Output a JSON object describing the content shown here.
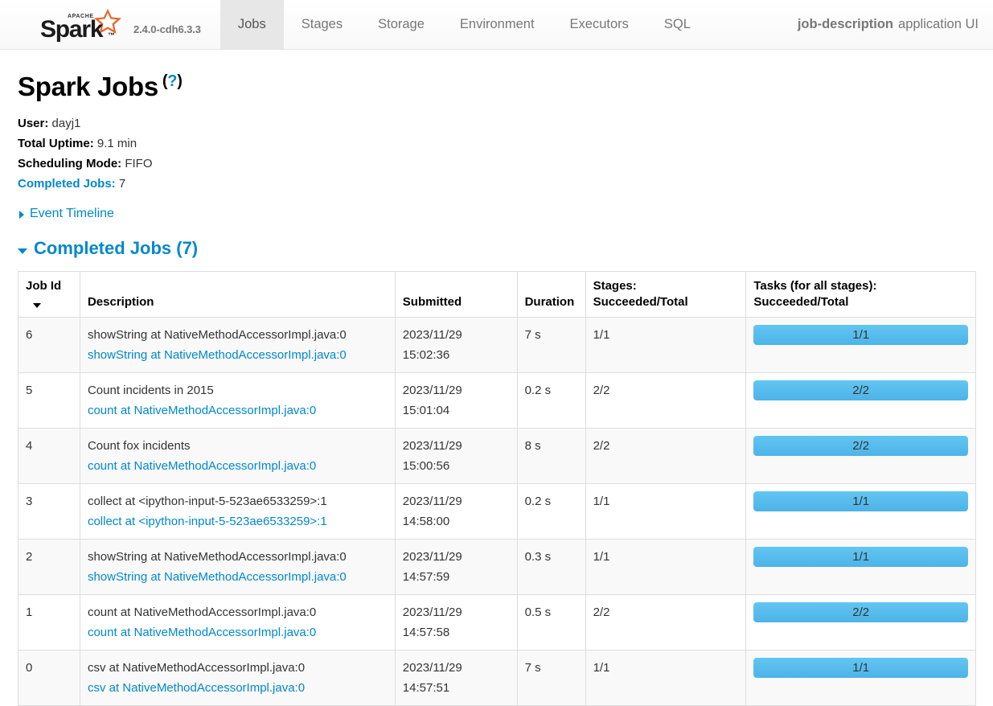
{
  "navbar": {
    "brand": {
      "name": "Spark",
      "apache": "APACHE",
      "icon": "spark-logo-icon"
    },
    "version": "2.4.0-cdh6.3.3",
    "tabs": [
      {
        "label": "Jobs",
        "active": true
      },
      {
        "label": "Stages",
        "active": false
      },
      {
        "label": "Storage",
        "active": false
      },
      {
        "label": "Environment",
        "active": false
      },
      {
        "label": "Executors",
        "active": false
      },
      {
        "label": "SQL",
        "active": false
      }
    ],
    "app_name": "job-description",
    "app_suffix": "application UI"
  },
  "page": {
    "title": "Spark Jobs",
    "help_open": "(",
    "help_mark": "?",
    "help_close": ")"
  },
  "summary": {
    "user_label": "User:",
    "user_value": "dayj1",
    "uptime_label": "Total Uptime:",
    "uptime_value": "9.1 min",
    "scheduling_label": "Scheduling Mode:",
    "scheduling_value": "FIFO",
    "completed_label": "Completed Jobs:",
    "completed_value": "7"
  },
  "event_timeline": {
    "label": "Event Timeline"
  },
  "completed_section": {
    "title": "Completed Jobs (7)"
  },
  "table": {
    "headers": {
      "job_id": "Job Id",
      "description": "Description",
      "submitted": "Submitted",
      "duration": "Duration",
      "stages_l1": "Stages:",
      "stages_l2": "Succeeded/Total",
      "tasks_l1": "Tasks (for all stages):",
      "tasks_l2": "Succeeded/Total"
    },
    "rows": [
      {
        "job_id": "6",
        "desc_main": "showString at NativeMethodAccessorImpl.java:0",
        "desc_link": "showString at NativeMethodAccessorImpl.java:0",
        "submitted_date": "2023/11/29",
        "submitted_time": "15:02:36",
        "duration": "7 s",
        "stages": "1/1",
        "tasks": "1/1"
      },
      {
        "job_id": "5",
        "desc_main": "Count incidents in 2015",
        "desc_link": "count at NativeMethodAccessorImpl.java:0",
        "submitted_date": "2023/11/29",
        "submitted_time": "15:01:04",
        "duration": "0.2 s",
        "stages": "2/2",
        "tasks": "2/2"
      },
      {
        "job_id": "4",
        "desc_main": "Count fox incidents",
        "desc_link": "count at NativeMethodAccessorImpl.java:0",
        "submitted_date": "2023/11/29",
        "submitted_time": "15:00:56",
        "duration": "8 s",
        "stages": "2/2",
        "tasks": "2/2"
      },
      {
        "job_id": "3",
        "desc_main": "collect at <ipython-input-5-523ae6533259>:1",
        "desc_link": "collect at <ipython-input-5-523ae6533259>:1",
        "submitted_date": "2023/11/29",
        "submitted_time": "14:58:00",
        "duration": "0.2 s",
        "stages": "1/1",
        "tasks": "1/1"
      },
      {
        "job_id": "2",
        "desc_main": "showString at NativeMethodAccessorImpl.java:0",
        "desc_link": "showString at NativeMethodAccessorImpl.java:0",
        "submitted_date": "2023/11/29",
        "submitted_time": "14:57:59",
        "duration": "0.3 s",
        "stages": "1/1",
        "tasks": "1/1"
      },
      {
        "job_id": "1",
        "desc_main": "count at NativeMethodAccessorImpl.java:0",
        "desc_link": "count at NativeMethodAccessorImpl.java:0",
        "submitted_date": "2023/11/29",
        "submitted_time": "14:57:58",
        "duration": "0.5 s",
        "stages": "2/2",
        "tasks": "2/2"
      },
      {
        "job_id": "0",
        "desc_main": "csv at NativeMethodAccessorImpl.java:0",
        "desc_link": "csv at NativeMethodAccessorImpl.java:0",
        "submitted_date": "2023/11/29",
        "submitted_time": "14:57:51",
        "duration": "7 s",
        "stages": "1/1",
        "tasks": "1/1"
      }
    ]
  },
  "colors": {
    "link": "#0088cc",
    "progress_bar": "#4db3e8",
    "nav_active_bg": "#e7e7e7",
    "row_stripe": "#f9f9f9",
    "border": "#dddddd",
    "spark_orange": "#e25a1c"
  }
}
